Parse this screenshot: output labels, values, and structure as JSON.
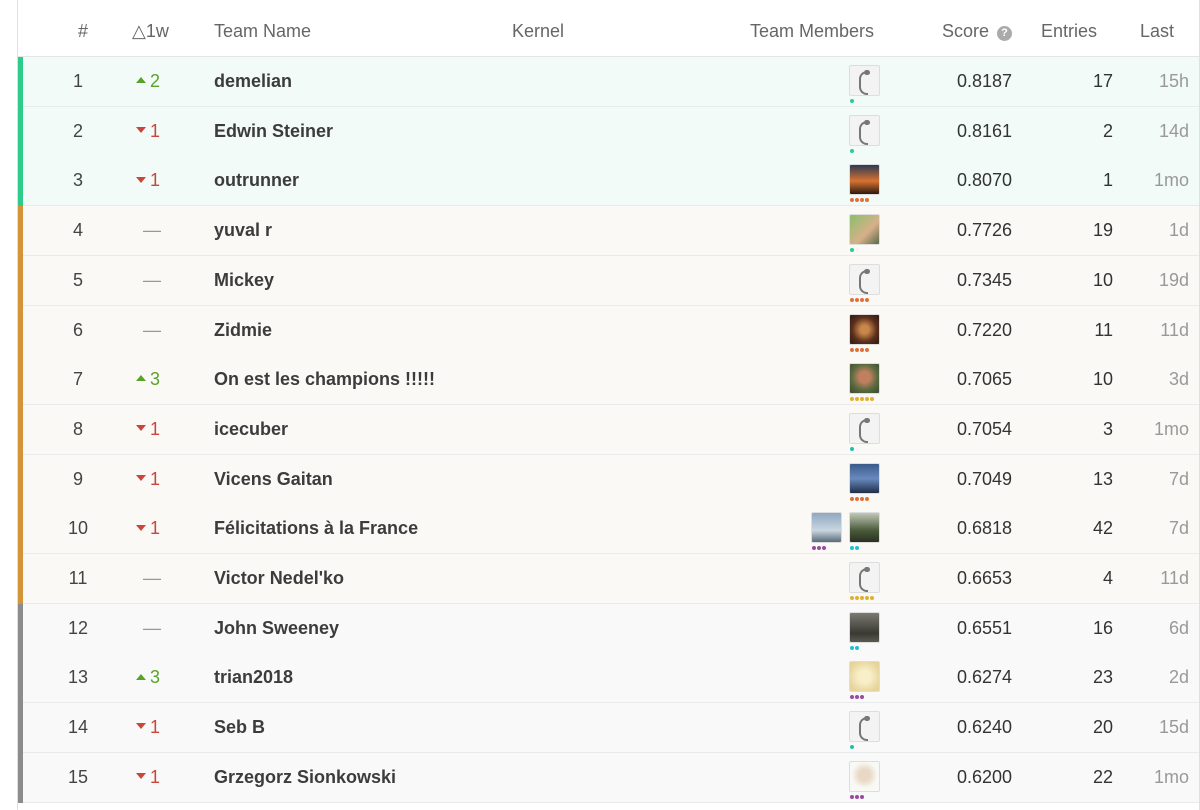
{
  "header": {
    "rank": "#",
    "delta": "△1w",
    "team_name": "Team Name",
    "kernel": "Kernel",
    "team_members": "Team Members",
    "score": "Score",
    "entries": "Entries",
    "last": "Last"
  },
  "colors": {
    "gold": "#2ecc8a",
    "silver": "#d4943a",
    "bronze": "#8c8c8c",
    "up": "#5aa32a",
    "down": "#c9463d"
  },
  "rows": [
    {
      "rank": "1",
      "delta": "2",
      "dir": "up",
      "team": "demelian",
      "avatars": [
        {
          "type": "goose",
          "dots": [
            "#2ecc8a"
          ]
        }
      ],
      "score": "0.8187",
      "entries": "17",
      "last": "15h",
      "tier": "gold"
    },
    {
      "rank": "2",
      "delta": "1",
      "dir": "down",
      "team": "Edwin Steiner",
      "avatars": [
        {
          "type": "goose",
          "dots": [
            "#2ecc8a"
          ]
        }
      ],
      "score": "0.8161",
      "entries": "2",
      "last": "14d",
      "tier": "gold"
    },
    {
      "rank": "3",
      "delta": "1",
      "dir": "down",
      "team": "outrunner",
      "avatars": [
        {
          "type": "sunset",
          "dots": [
            "#e0703a",
            "#e0703a",
            "#e0703a",
            "#e0703a"
          ]
        }
      ],
      "score": "0.8070",
      "entries": "1",
      "last": "1mo",
      "tier": "gold"
    },
    {
      "rank": "4",
      "delta": "—",
      "dir": "same",
      "team": "yuval r",
      "avatars": [
        {
          "type": "runner",
          "dots": [
            "#2ecc8a"
          ]
        }
      ],
      "score": "0.7726",
      "entries": "19",
      "last": "1d",
      "tier": "silver"
    },
    {
      "rank": "5",
      "delta": "—",
      "dir": "same",
      "team": "Mickey",
      "avatars": [
        {
          "type": "goose",
          "dots": [
            "#e0703a",
            "#e0703a",
            "#e0703a",
            "#e0703a"
          ]
        }
      ],
      "score": "0.7345",
      "entries": "10",
      "last": "19d",
      "tier": "silver"
    },
    {
      "rank": "6",
      "delta": "—",
      "dir": "same",
      "team": "Zidmie",
      "avatars": [
        {
          "type": "food",
          "dots": [
            "#e0703a",
            "#e0703a",
            "#e0703a",
            "#e0703a"
          ]
        }
      ],
      "score": "0.7220",
      "entries": "11",
      "last": "11d",
      "tier": "silver"
    },
    {
      "rank": "7",
      "delta": "3",
      "dir": "up",
      "team": "On est les champions !!!!!",
      "avatars": [
        {
          "type": "face",
          "dots": [
            "#e0b030",
            "#e0b030",
            "#e0b030",
            "#e0b030",
            "#e0b030"
          ]
        }
      ],
      "score": "0.7065",
      "entries": "10",
      "last": "3d",
      "tier": "silver"
    },
    {
      "rank": "8",
      "delta": "1",
      "dir": "down",
      "team": "icecuber",
      "avatars": [
        {
          "type": "goose",
          "dots": [
            "#20c0b0"
          ]
        }
      ],
      "score": "0.7054",
      "entries": "3",
      "last": "1mo",
      "tier": "silver"
    },
    {
      "rank": "9",
      "delta": "1",
      "dir": "down",
      "team": "Vicens Gaitan",
      "avatars": [
        {
          "type": "person",
          "dots": [
            "#e0703a",
            "#e0703a",
            "#e0703a",
            "#e0703a"
          ]
        }
      ],
      "score": "0.7049",
      "entries": "13",
      "last": "7d",
      "tier": "silver"
    },
    {
      "rank": "10",
      "delta": "1",
      "dir": "down",
      "team": "Félicitations à la France",
      "avatars": [
        {
          "type": "sky",
          "dots": [
            "#9a4aa0",
            "#9a4aa0",
            "#9a4aa0"
          ]
        },
        {
          "type": "landscape",
          "dots": [
            "#20c0d0",
            "#20c0d0"
          ]
        }
      ],
      "score": "0.6818",
      "entries": "42",
      "last": "7d",
      "tier": "silver"
    },
    {
      "rank": "11",
      "delta": "—",
      "dir": "same",
      "team": "Victor Nedel'ko",
      "avatars": [
        {
          "type": "goose",
          "dots": [
            "#e0b030",
            "#e0b030",
            "#e0b030",
            "#e0b030",
            "#e0b030"
          ]
        }
      ],
      "score": "0.6653",
      "entries": "4",
      "last": "11d",
      "tier": "silver"
    },
    {
      "rank": "12",
      "delta": "—",
      "dir": "same",
      "team": "John Sweeney",
      "avatars": [
        {
          "type": "forest",
          "dots": [
            "#20c0d0",
            "#20c0d0"
          ]
        }
      ],
      "score": "0.6551",
      "entries": "16",
      "last": "6d",
      "tier": "bronze"
    },
    {
      "rank": "13",
      "delta": "3",
      "dir": "up",
      "team": "trian2018",
      "avatars": [
        {
          "type": "beige",
          "dots": [
            "#9a4aa0",
            "#9a4aa0",
            "#9a4aa0"
          ]
        }
      ],
      "score": "0.6274",
      "entries": "23",
      "last": "2d",
      "tier": "bronze"
    },
    {
      "rank": "14",
      "delta": "1",
      "dir": "down",
      "team": "Seb B",
      "avatars": [
        {
          "type": "goose",
          "dots": [
            "#20c0b0"
          ]
        }
      ],
      "score": "0.6240",
      "entries": "20",
      "last": "15d",
      "tier": "bronze"
    },
    {
      "rank": "15",
      "delta": "1",
      "dir": "down",
      "team": "Grzegorz Sionkowski",
      "avatars": [
        {
          "type": "portrait",
          "dots": [
            "#9a4aa0",
            "#9a4aa0",
            "#9a4aa0"
          ]
        }
      ],
      "score": "0.6200",
      "entries": "22",
      "last": "1mo",
      "tier": "bronze"
    }
  ]
}
